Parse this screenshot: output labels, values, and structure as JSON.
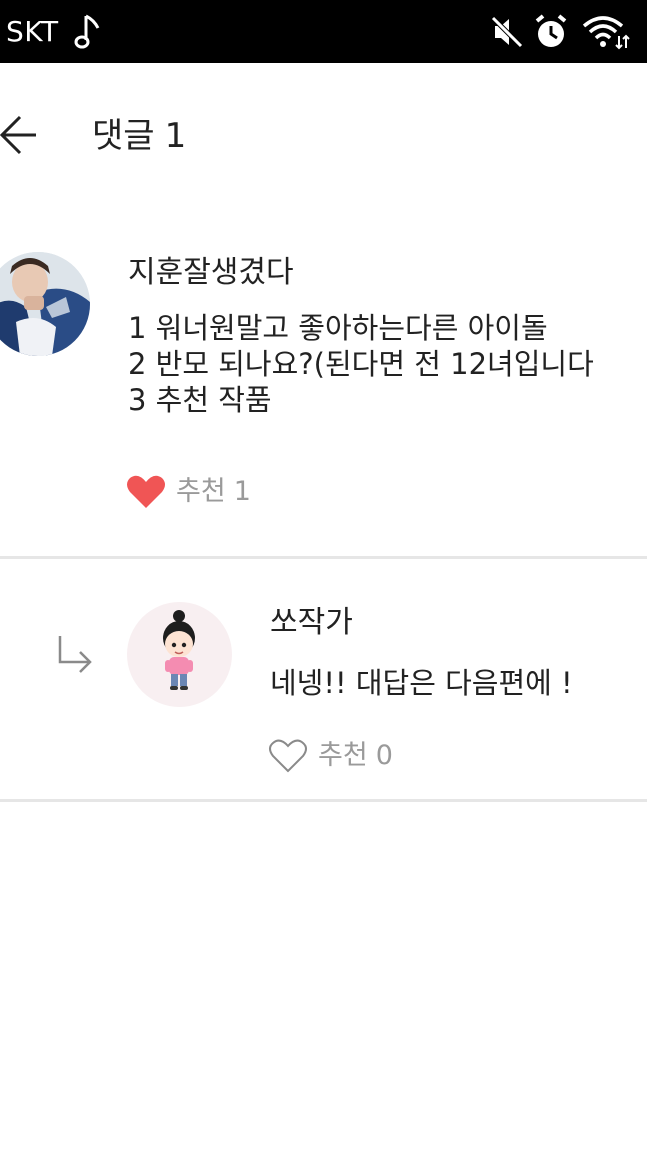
{
  "status_bar": {
    "carrier": "SKT",
    "icons": [
      "music-note-icon",
      "mute-icon",
      "alarm-icon",
      "wifi-icon"
    ]
  },
  "header": {
    "title": "댓글",
    "count": "1"
  },
  "comments": [
    {
      "author": "지훈잘생겼다",
      "lines": [
        "1 워너원말고 좋아하는다른 아이돌",
        "2 반모 되나요?(된다면 전 12녀입니다",
        "3  추천 작품"
      ],
      "like_label": "추천",
      "like_count": "1",
      "liked": true
    }
  ],
  "reply": {
    "author": "쏘작가",
    "text": "네넹!! 대답은 다음편에 !",
    "like_label": "추천",
    "like_count": "0",
    "liked": false
  },
  "colors": {
    "heart_filled": "#f05555",
    "muted_text": "#9a9a9a",
    "divider": "#e6e6e6"
  }
}
